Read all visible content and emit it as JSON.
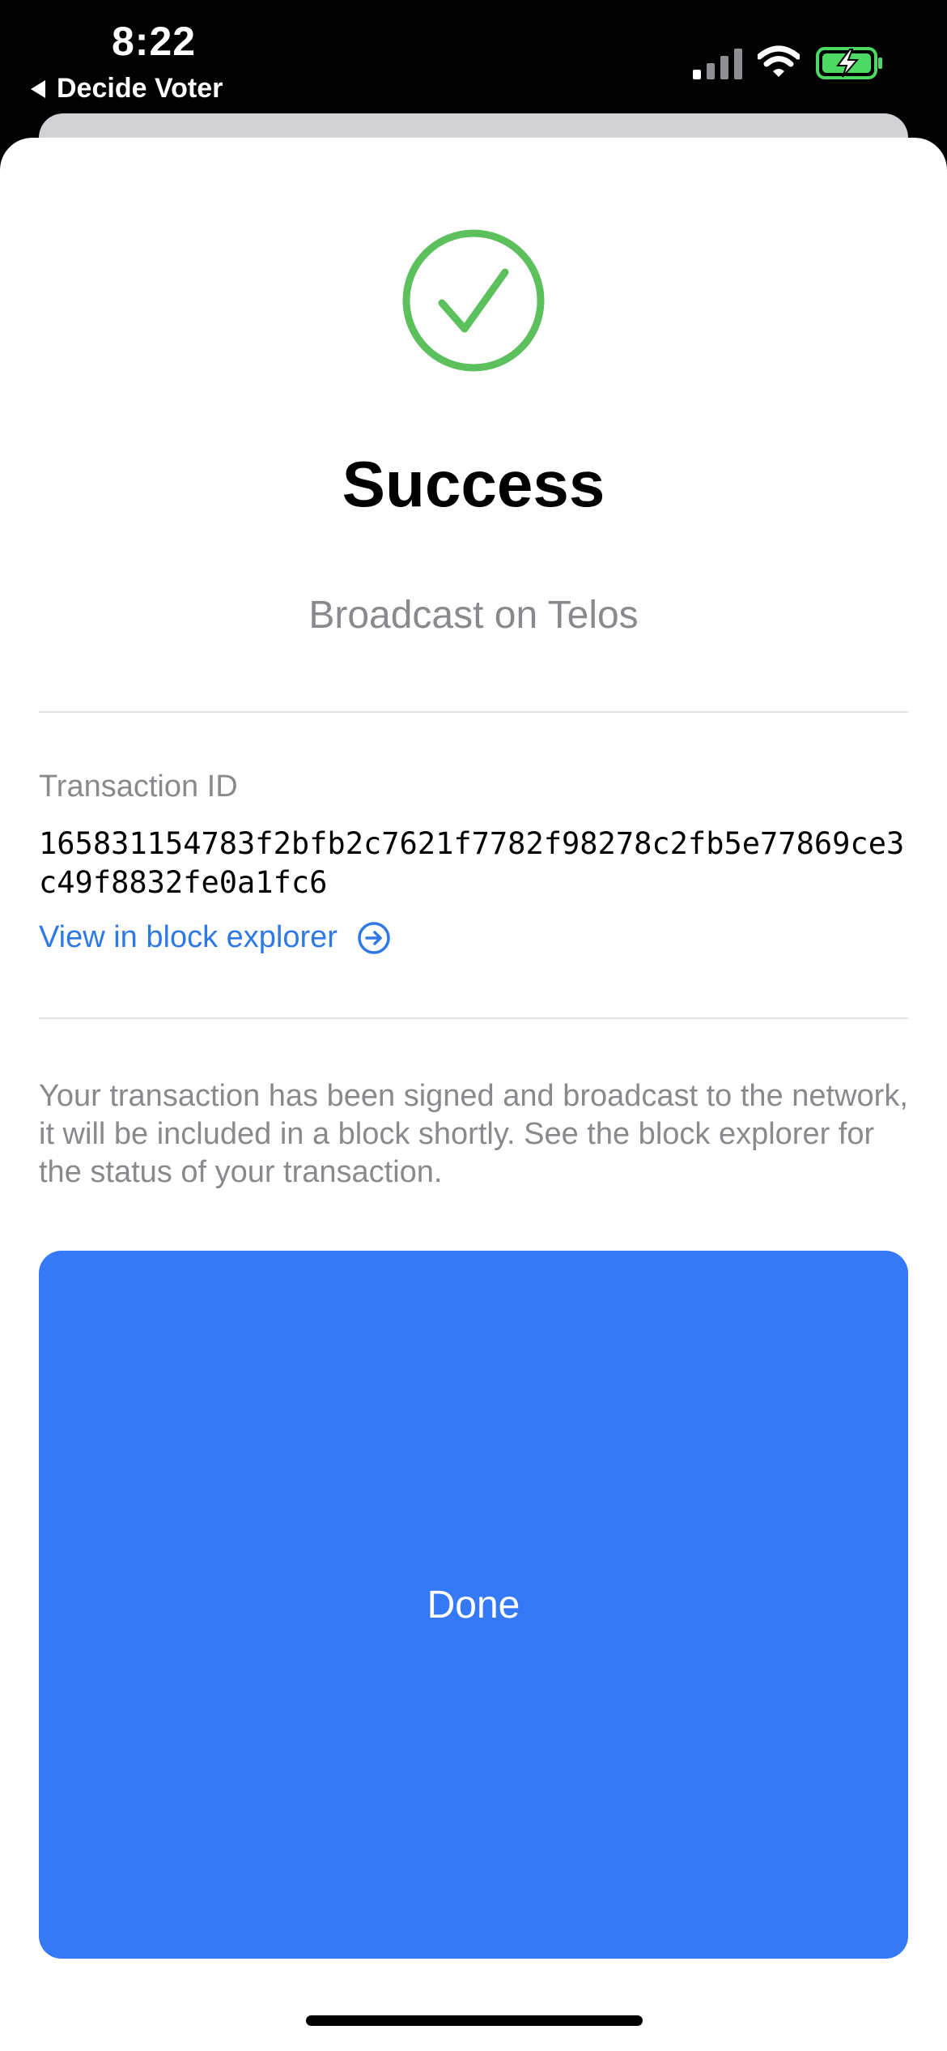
{
  "status_bar": {
    "time": "8:22",
    "back_app_label": "Decide Voter",
    "icons": [
      "cellular-signal-icon",
      "wifi-icon",
      "battery-charging-icon"
    ],
    "battery_color": "#4cd964"
  },
  "result": {
    "icon": "checkmark-circle-icon",
    "icon_color": "#5cc05c",
    "title": "Success",
    "subtitle": "Broadcast on Telos"
  },
  "transaction": {
    "label": "Transaction ID",
    "id": "165831154783f2bfb2c7621f7782f98278c2fb5e77869ce3c49f8832fe0a1fc6",
    "explorer_link_label": "View in block explorer",
    "explorer_link_icon": "arrow-right-circle-icon",
    "link_color": "#2f79e6"
  },
  "info_text": "Your transaction has been signed and broadcast to the network, it will be included in a block shortly. See the block explorer for the status of your transaction.",
  "done_button": {
    "label": "Done",
    "color": "#3579f6"
  }
}
